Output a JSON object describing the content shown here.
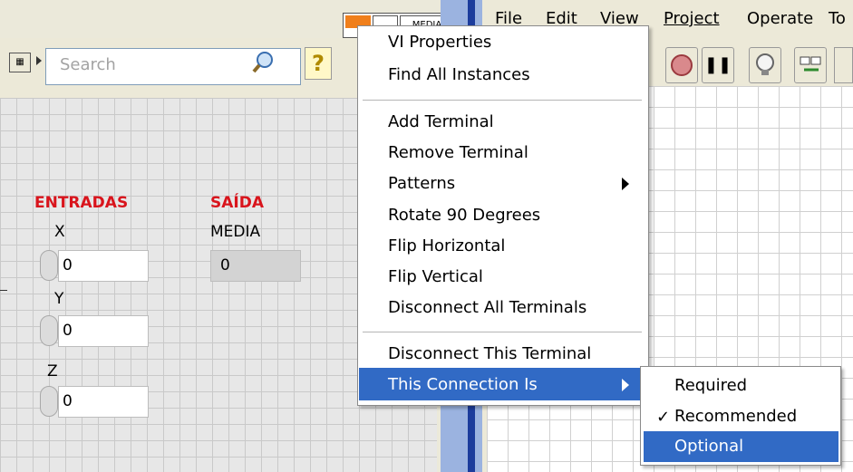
{
  "front_panel": {
    "search_placeholder": "Search",
    "inputs_heading": "ENTRADAS",
    "output_heading": "SAÍDA",
    "controls": [
      {
        "label": "X",
        "value": "0"
      },
      {
        "label": "Y",
        "value": "0"
      },
      {
        "label": "Z",
        "value": "0"
      }
    ],
    "indicator": {
      "label": "MEDIA",
      "value": "0"
    },
    "connector_label": "MEDIA"
  },
  "block_diagram": {
    "menu": [
      "File",
      "Edit",
      "View",
      "Project",
      "Operate",
      "To"
    ]
  },
  "context_menu": {
    "group1": [
      "VI Properties",
      "Find All Instances"
    ],
    "group2": [
      "Add Terminal",
      "Remove Terminal",
      "Patterns",
      "Rotate 90 Degrees",
      "Flip Horizontal",
      "Flip Vertical",
      "Disconnect All Terminals"
    ],
    "group3": [
      "Disconnect This Terminal",
      "This Connection Is"
    ],
    "highlighted": "This Connection Is"
  },
  "submenu": {
    "items": [
      "Required",
      "Recommended",
      "Optional"
    ],
    "checked": "Recommended",
    "highlighted": "Optional",
    "checkmark": "✓"
  },
  "colors": {
    "highlight": "#316ac5",
    "heading_red": "#d9141c"
  }
}
